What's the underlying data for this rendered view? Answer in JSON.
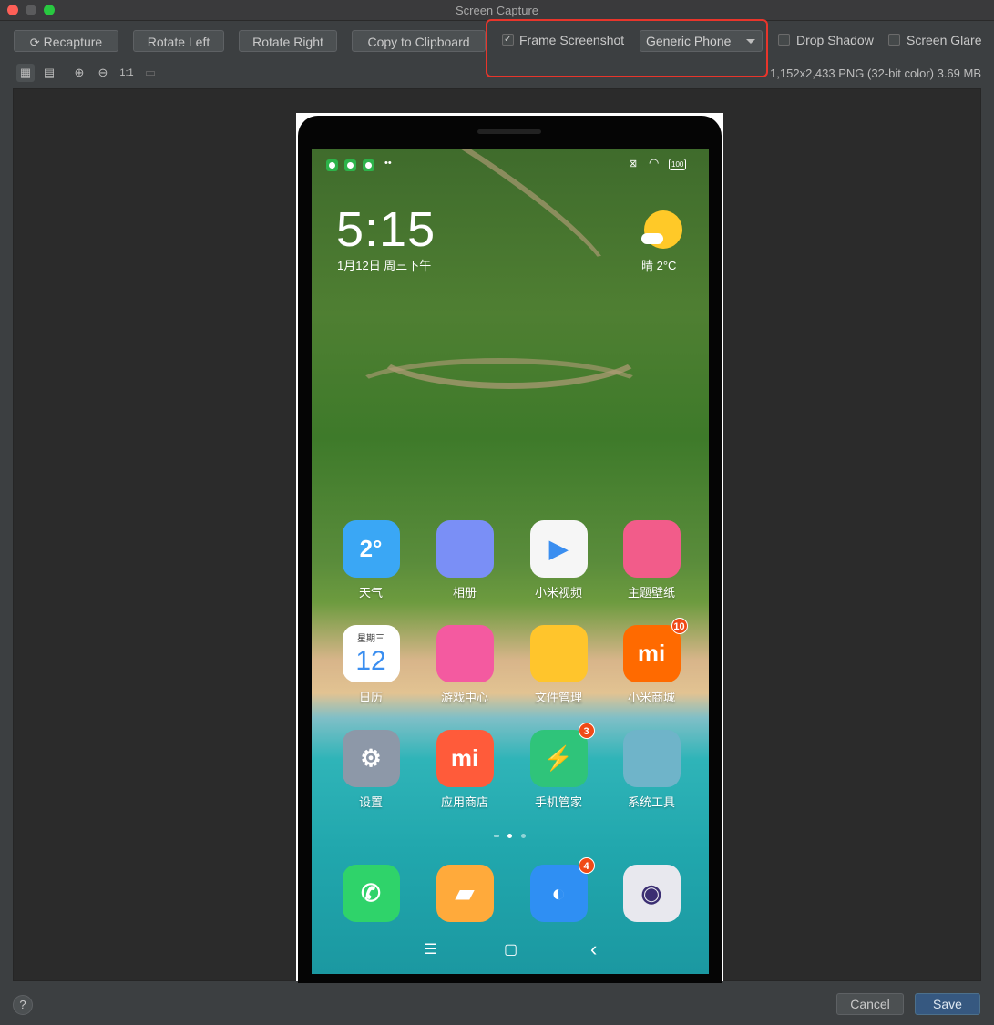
{
  "window": {
    "title": "Screen Capture"
  },
  "toolbar": {
    "recapture": "Recapture",
    "rotate_left": "Rotate Left",
    "rotate_right": "Rotate Right",
    "copy": "Copy to Clipboard",
    "frame_screenshot": "Frame Screenshot",
    "frame_checked": true,
    "frame_select": "Generic Phone",
    "drop_shadow": "Drop Shadow",
    "screen_glare": "Screen Glare"
  },
  "view_tools": {
    "actual_size": "1:1"
  },
  "image_info": "1,152x2,433 PNG (32-bit color) 3.69 MB",
  "phone": {
    "time": "5:15",
    "date": "1月12日 周三下午",
    "weather": "晴  2°C",
    "battery": "100",
    "apps": [
      {
        "label": "天气",
        "glyph": "2°",
        "color": "#3aa7f5",
        "badge": ""
      },
      {
        "label": "相册",
        "glyph": "",
        "color": "#7a8ff6",
        "badge": ""
      },
      {
        "label": "小米视频",
        "glyph": "▶",
        "color": "#f6f6f6",
        "badge": ""
      },
      {
        "label": "主题壁纸",
        "glyph": "",
        "color": "#f25c8a",
        "badge": ""
      },
      {
        "label": "日历",
        "glyph": "12",
        "color": "#ffffff",
        "badge": ""
      },
      {
        "label": "游戏中心",
        "glyph": "",
        "color": "#f45aa0",
        "badge": ""
      },
      {
        "label": "文件管理",
        "glyph": "",
        "color": "#ffc52c",
        "badge": ""
      },
      {
        "label": "小米商城",
        "glyph": "mi",
        "color": "#ff6a00",
        "badge": "10"
      },
      {
        "label": "设置",
        "glyph": "⚙",
        "color": "#8d98a8",
        "badge": ""
      },
      {
        "label": "应用商店",
        "glyph": "mi",
        "color": "#ff5b3a",
        "badge": ""
      },
      {
        "label": "手机管家",
        "glyph": "⚡",
        "color": "#2fc47a",
        "badge": "3"
      },
      {
        "label": "系统工具",
        "glyph": "",
        "color": "#6fb4c9",
        "badge": ""
      }
    ],
    "calendar_weekday": "星期三",
    "dock": [
      {
        "name": "phone",
        "color": "#2fd36a",
        "glyph": "✆",
        "badge": ""
      },
      {
        "name": "messages",
        "color": "#ffaa3b",
        "glyph": "▰",
        "badge": ""
      },
      {
        "name": "browser",
        "color": "#2f8ff3",
        "glyph": "◐",
        "badge": "4"
      },
      {
        "name": "camera",
        "color": "#e8e8ee",
        "glyph": "◉",
        "badge": ""
      }
    ],
    "nav": {
      "menu": "☰",
      "home": "▢",
      "back": "‹"
    }
  },
  "footer": {
    "help": "?",
    "cancel": "Cancel",
    "save": "Save"
  }
}
